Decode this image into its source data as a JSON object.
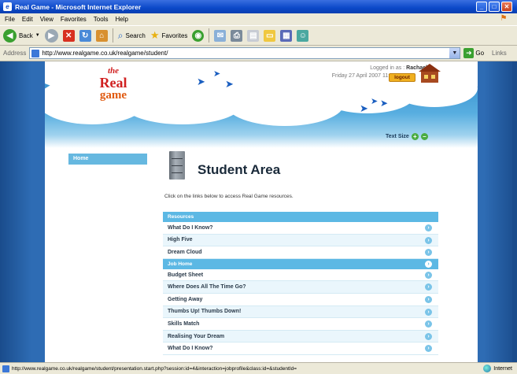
{
  "window": {
    "title": "Real Game - Microsoft Internet Explorer"
  },
  "menu": [
    "File",
    "Edit",
    "View",
    "Favorites",
    "Tools",
    "Help"
  ],
  "toolbar": {
    "back": "Back",
    "search": "Search",
    "favorites": "Favorites"
  },
  "address": {
    "label": "Address",
    "url": "http://www.realgame.co.uk/realgame/student/",
    "go": "Go",
    "links": "Links"
  },
  "header": {
    "logo": {
      "line1": "the",
      "line2": "Real",
      "line3": "game"
    },
    "logged_in": "Logged in as : ",
    "user": "Rachael",
    "date": "Friday 27 April 2007",
    "time": "11:57",
    "logout": "logout",
    "text_size": "Text Size"
  },
  "sidebar": {
    "items": [
      {
        "label": "Home"
      }
    ]
  },
  "main": {
    "title": "Student Area",
    "intro": "Click on the links below to access Real Game resources.",
    "sections": [
      {
        "heading": "Resources",
        "items": [
          "What Do I Know?",
          "High Five",
          "Dream Cloud"
        ]
      },
      {
        "heading": "Job Home",
        "items": [
          "Budget Sheet",
          "Where Does All The Time Go?",
          "Getting Away",
          "Thumbs Up! Thumbs Down!",
          "Skills Match",
          "Realising Your Dream",
          "What Do I Know?"
        ]
      }
    ]
  },
  "status": {
    "url": "http://www.realgame.co.uk/realgame/student/presentation.start.php?session:id=4&interaction=jobprofile&class:id=&studentId=",
    "zone": "Internet"
  },
  "colors": {
    "ie_title": "#0b48c8",
    "section_blue": "#5cb8e4",
    "background_blue": "#2e6cb4",
    "logout": "#f0b020"
  }
}
